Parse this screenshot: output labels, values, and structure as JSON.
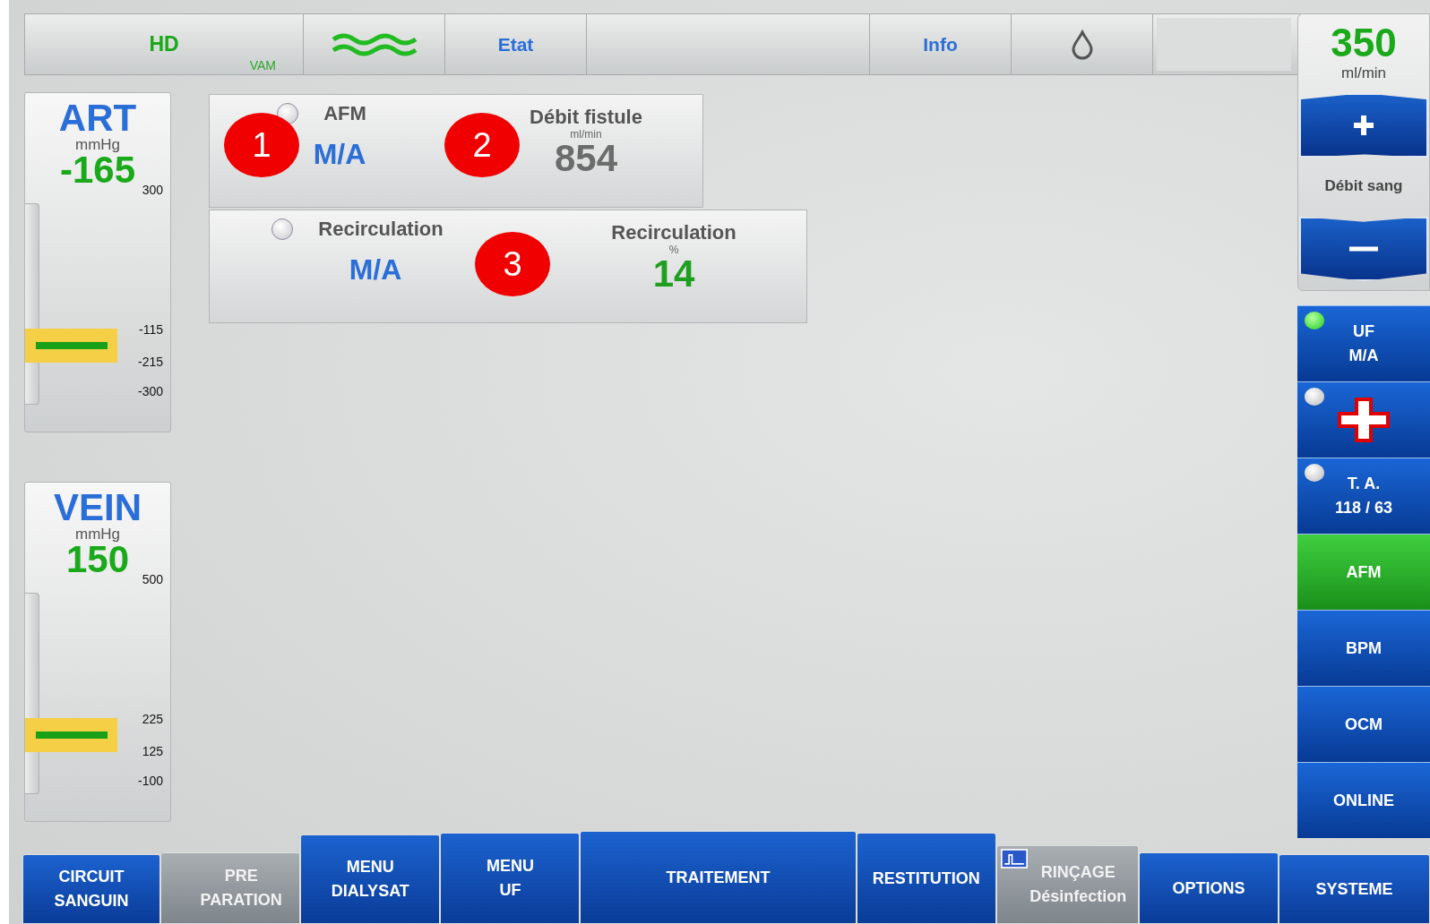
{
  "top_bar": {
    "mode": "HD",
    "mode_sub": "VAM",
    "tabs": [
      {
        "kind": "wave"
      },
      {
        "kind": "text",
        "label": "Etat"
      },
      {
        "kind": "empty"
      },
      {
        "kind": "text",
        "label": "Info"
      },
      {
        "kind": "drop"
      },
      {
        "kind": "box"
      }
    ]
  },
  "gauges": [
    {
      "title": "ART",
      "unit": "mmHg",
      "value": "-165",
      "top_label": "300",
      "scale": [
        "-115",
        "-215",
        "-300"
      ]
    },
    {
      "title": "VEIN",
      "unit": "mmHg",
      "value": "150",
      "top_label": "500",
      "scale": [
        "225",
        "125",
        "-100"
      ]
    }
  ],
  "panels": [
    {
      "indicator_on": false,
      "left_label": "AFM",
      "left_value": "M/A",
      "right_label": "Débit fistule",
      "right_unit": "ml/min",
      "right_value": "854",
      "color": "#6c6c6c"
    },
    {
      "indicator_on": false,
      "left_label": "Recirculation",
      "left_value": "M/A",
      "right_label": "Recirculation",
      "right_unit": "%",
      "right_value": "14",
      "color": "#1f9f1f"
    }
  ],
  "annotations": [
    "1",
    "2",
    "3"
  ],
  "blood_pump": {
    "value": "350",
    "unit": "ml/min",
    "label": "Débit sang"
  },
  "side_buttons": [
    {
      "kind": "text",
      "lines": [
        "UF",
        "M/A"
      ],
      "indicator_on": true,
      "selected": false
    },
    {
      "kind": "cross",
      "indicator_on": false,
      "selected": false
    },
    {
      "kind": "text",
      "lines": [
        "T. A.",
        "118 / 63"
      ],
      "indicator_on": false,
      "selected": false
    },
    {
      "kind": "text",
      "lines": [
        "AFM"
      ],
      "selected": true
    },
    {
      "kind": "text",
      "lines": [
        "BPM"
      ],
      "selected": false
    },
    {
      "kind": "text",
      "lines": [
        "OCM"
      ],
      "selected": false
    },
    {
      "kind": "text",
      "lines": [
        "ONLINE"
      ],
      "selected": false
    }
  ],
  "bottom_nav": [
    {
      "lines": [
        "CIRCUIT",
        "SANGUIN"
      ],
      "disabled": false
    },
    {
      "lines": [
        "PRE",
        "PARATION"
      ],
      "disabled": true
    },
    {
      "lines": [
        "MENU",
        "DIALYSAT"
      ],
      "disabled": false
    },
    {
      "lines": [
        "MENU",
        "UF"
      ],
      "disabled": false
    },
    {
      "lines": [
        "TRAITEMENT"
      ],
      "disabled": false
    },
    {
      "lines": [
        "RESTITUTION"
      ],
      "disabled": false
    },
    {
      "lines": [
        "RINÇAGE",
        "Désinfection"
      ],
      "disabled": true,
      "icon": true
    },
    {
      "lines": [
        "OPTIONS"
      ],
      "disabled": false
    },
    {
      "lines": [
        "SYSTEME"
      ],
      "disabled": false
    }
  ]
}
